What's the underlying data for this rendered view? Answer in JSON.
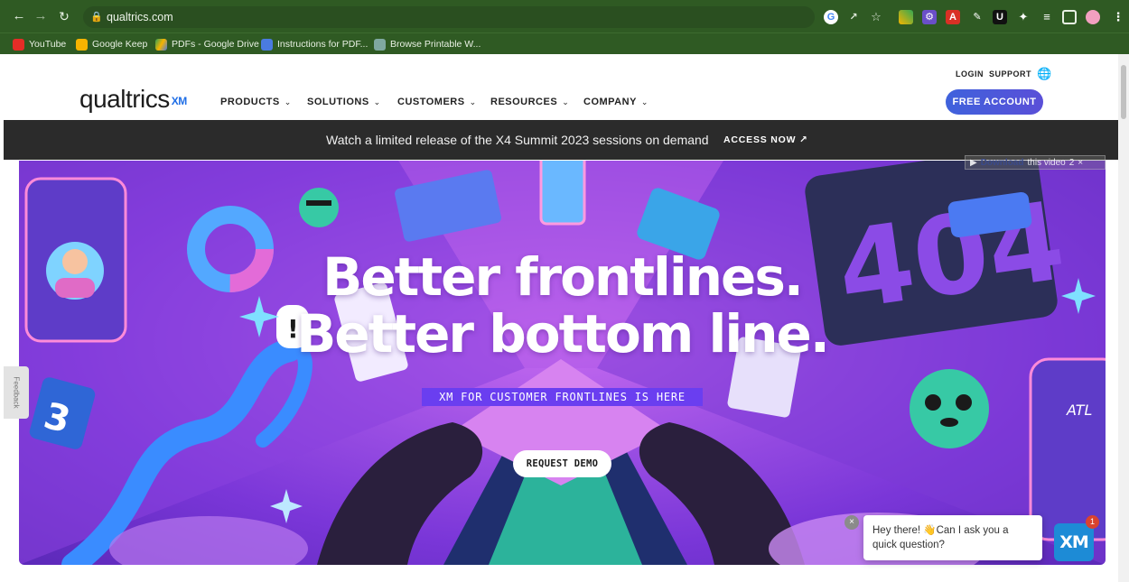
{
  "browser": {
    "url": "qualtrics.com",
    "bookmarks": [
      {
        "label": "YouTube",
        "color": "#e52d27"
      },
      {
        "label": "Google Keep",
        "color": "#f6b400"
      },
      {
        "label": "PDFs - Google Drive",
        "color": "#2f9e57"
      },
      {
        "label": "Instructions for PDF...",
        "color": "#4a7be0"
      },
      {
        "label": "Browse Printable W...",
        "color": "#7fa8a0"
      }
    ],
    "nav_icons": {
      "back": "arrow-left-icon",
      "forward": "arrow-right-icon",
      "reload": "reload-icon"
    },
    "extension_icons": [
      "google-icon",
      "share-icon",
      "star-icon",
      "colorful-ext-icon",
      "gear-ext-icon",
      "pdf-ext-icon",
      "paint-ext-icon",
      "u-ext-icon",
      "puzzle-icon",
      "playlist-icon",
      "sidebar-icon",
      "profile-avatar-icon",
      "kebab-menu-icon"
    ]
  },
  "header": {
    "logo_text": "qualtrics",
    "logo_sup": "XM",
    "menu": [
      {
        "label": "PRODUCTS"
      },
      {
        "label": "SOLUTIONS"
      },
      {
        "label": "CUSTOMERS"
      },
      {
        "label": "RESOURCES"
      },
      {
        "label": "COMPANY"
      }
    ],
    "login": "LOGIN",
    "support": "SUPPORT",
    "free_account": "FREE ACCOUNT"
  },
  "promo": {
    "message": "Watch a limited release of the X4 Summit 2023 sessions on demand",
    "cta": "ACCESS NOW ↗"
  },
  "hero": {
    "line1": "Better frontlines.",
    "line2": "Better bottom line.",
    "tag": "XM FOR CUSTOMER FRONTLINES IS HERE",
    "cta": "REQUEST DEMO",
    "accent_color": "#6a3ef0"
  },
  "overlay": {
    "download": "Download",
    "rest": "this video",
    "count": "2"
  },
  "feedback_tab": "Feedback",
  "chat": {
    "message": "Hey there! 👋Can I ask you a quick question?",
    "launcher": "XM",
    "badge": "1"
  }
}
